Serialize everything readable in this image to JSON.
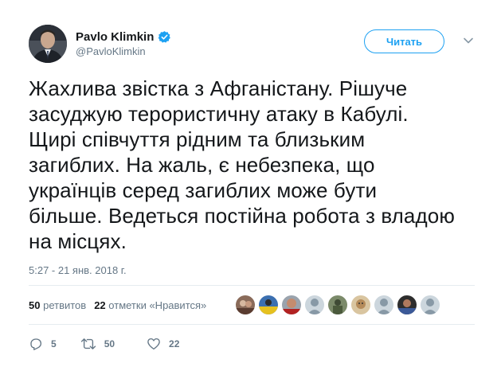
{
  "author": {
    "name": "Pavlo Klimkin",
    "handle": "@PavloKlimkin",
    "verified": true
  },
  "follow_button": {
    "label": "Читать"
  },
  "tweet": {
    "text_lines": [
      "Жахлива звістка з Афганістану. Рішуче",
      "засуджую терористичну атаку в Кабулі.",
      "Щирі співчуття рідним та близьким",
      "загиблих. На жаль, є небезпека, що",
      "українців серед загиблих може бути",
      "більше. Ведеться постійна робота з владою",
      "на місцях."
    ],
    "timestamp": "5:27 - 21 янв. 2018 г."
  },
  "stats": {
    "retweets_count": "50",
    "retweets_label": "ретвитов",
    "likes_count": "22",
    "likes_label": "отметки «Нравится»"
  },
  "actions": {
    "reply_count": "5",
    "retweet_count": "50",
    "like_count": "22"
  },
  "colors": {
    "accent": "#1da1f2",
    "muted": "#657786",
    "text": "#14171a",
    "divider": "#e6ecf0"
  },
  "icons": [
    "verified-badge-icon",
    "chevron-down-icon",
    "reply-icon",
    "retweet-icon",
    "heart-icon"
  ]
}
